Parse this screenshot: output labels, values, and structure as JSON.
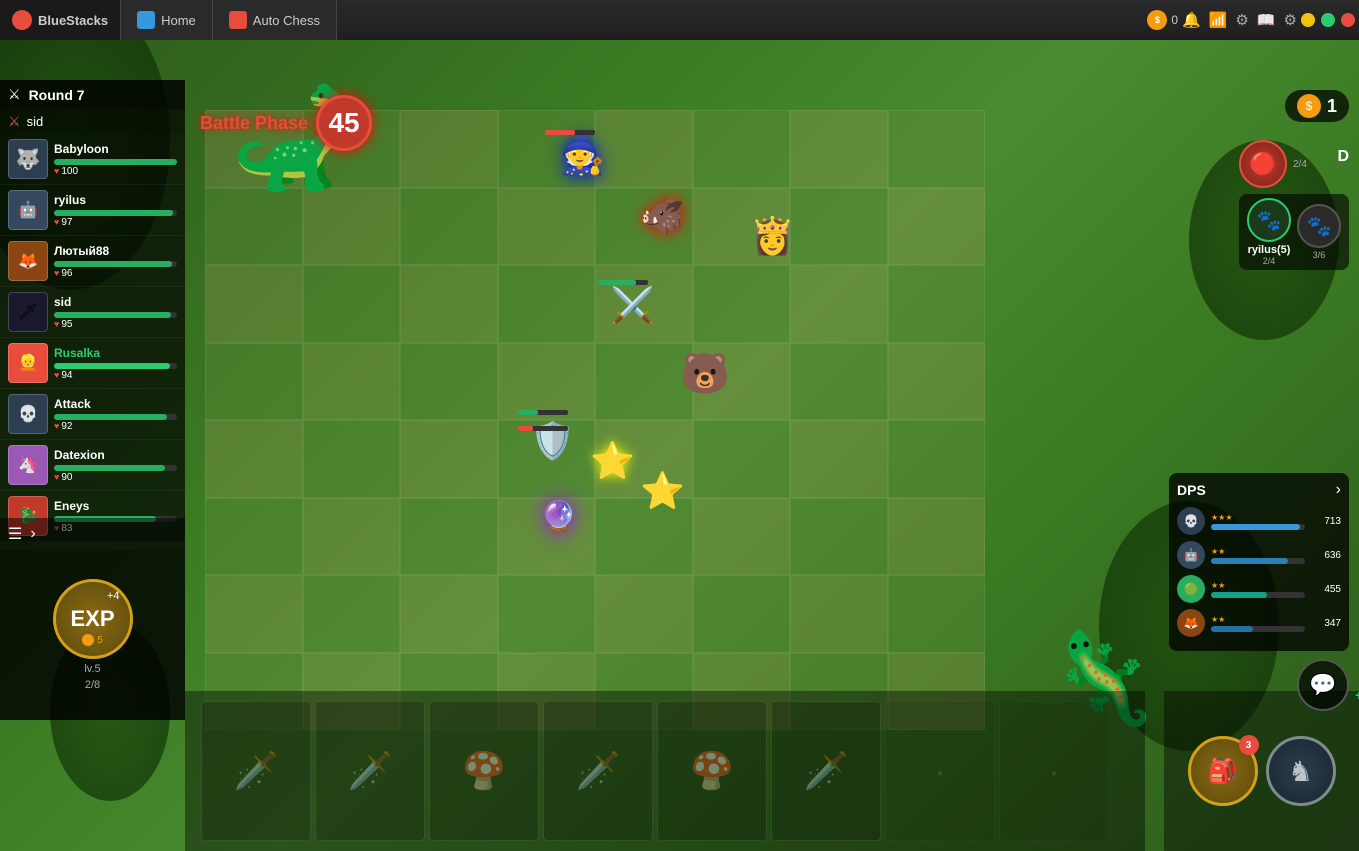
{
  "titlebar": {
    "brand": "BlueStacks",
    "tabs": [
      {
        "label": "Home",
        "type": "home"
      },
      {
        "label": "Auto Chess",
        "type": "chess"
      }
    ],
    "coin_value": "0",
    "window_buttons": [
      "minimize",
      "maximize",
      "close"
    ]
  },
  "game": {
    "round": "Round 7",
    "round_icon": "⚔",
    "phase": "Battle Phase",
    "timer": "45",
    "current_player": "sid",
    "gold": "1",
    "exp_label": "EXP",
    "exp_plus": "+4",
    "exp_cost": "5",
    "exp_level": "lv.5",
    "exp_progress": "2/8"
  },
  "players": [
    {
      "name": "Babyloon",
      "hp": 100,
      "max_hp": 100,
      "avatar": "🐺",
      "name_color": "normal"
    },
    {
      "name": "ryilus",
      "hp": 97,
      "max_hp": 100,
      "avatar": "🤖",
      "name_color": "normal"
    },
    {
      "name": "Лютый88",
      "hp": 96,
      "max_hp": 100,
      "avatar": "🦊",
      "name_color": "normal"
    },
    {
      "name": "sid",
      "hp": 95,
      "max_hp": 100,
      "avatar": "🗡",
      "name_color": "normal"
    },
    {
      "name": "Rusalka",
      "hp": 94,
      "max_hp": 100,
      "avatar": "👱",
      "name_color": "gold"
    },
    {
      "name": "Attack",
      "hp": 92,
      "max_hp": 100,
      "avatar": "💀",
      "name_color": "normal"
    },
    {
      "name": "Datexion",
      "hp": 90,
      "max_hp": 100,
      "avatar": "🦄",
      "name_color": "normal"
    },
    {
      "name": "Eneys",
      "hp": 83,
      "max_hp": 100,
      "avatar": "🐉",
      "name_color": "normal"
    }
  ],
  "right_players": [
    {
      "name": "ryilus(5)",
      "count1": "2/4",
      "count2": "2/4",
      "count3": "3/6",
      "avatar": "🐾",
      "border": "green"
    },
    {
      "name": "",
      "count": "",
      "avatar": "🐾",
      "border": "normal"
    }
  ],
  "dps_panel": {
    "title": "DPS",
    "entries": [
      {
        "stars": "★★★",
        "value": 713,
        "pct": 95,
        "avatar": "💀"
      },
      {
        "stars": "★★",
        "value": 636,
        "pct": 82,
        "avatar": "🤖"
      },
      {
        "stars": "★★",
        "value": 455,
        "pct": 60,
        "avatar": "🟢"
      },
      {
        "stars": "★★",
        "value": 347,
        "pct": 45,
        "avatar": "🦊"
      }
    ]
  },
  "bench": {
    "slots": [
      {
        "piece": "🗡️",
        "has_piece": true
      },
      {
        "piece": "🗡️",
        "has_piece": true
      },
      {
        "piece": "🍄",
        "has_piece": true
      },
      {
        "piece": "🗡️",
        "has_piece": true
      },
      {
        "piece": "🍄",
        "has_piece": true
      },
      {
        "piece": "🗡️",
        "has_piece": true
      },
      {
        "piece": "⬜",
        "has_piece": false
      },
      {
        "piece": "⬜",
        "has_piece": false
      }
    ]
  },
  "bottom_right": {
    "bag_count": "3",
    "bag_icon": "🎒",
    "add_icon": "♞"
  },
  "synergies": [
    {
      "icon": "🐾",
      "label": "Beast",
      "count": "2/4"
    },
    {
      "icon": "🐾",
      "label": "",
      "count": "2/4"
    },
    {
      "icon": "♞",
      "label": "",
      "count": "3/6"
    }
  ]
}
